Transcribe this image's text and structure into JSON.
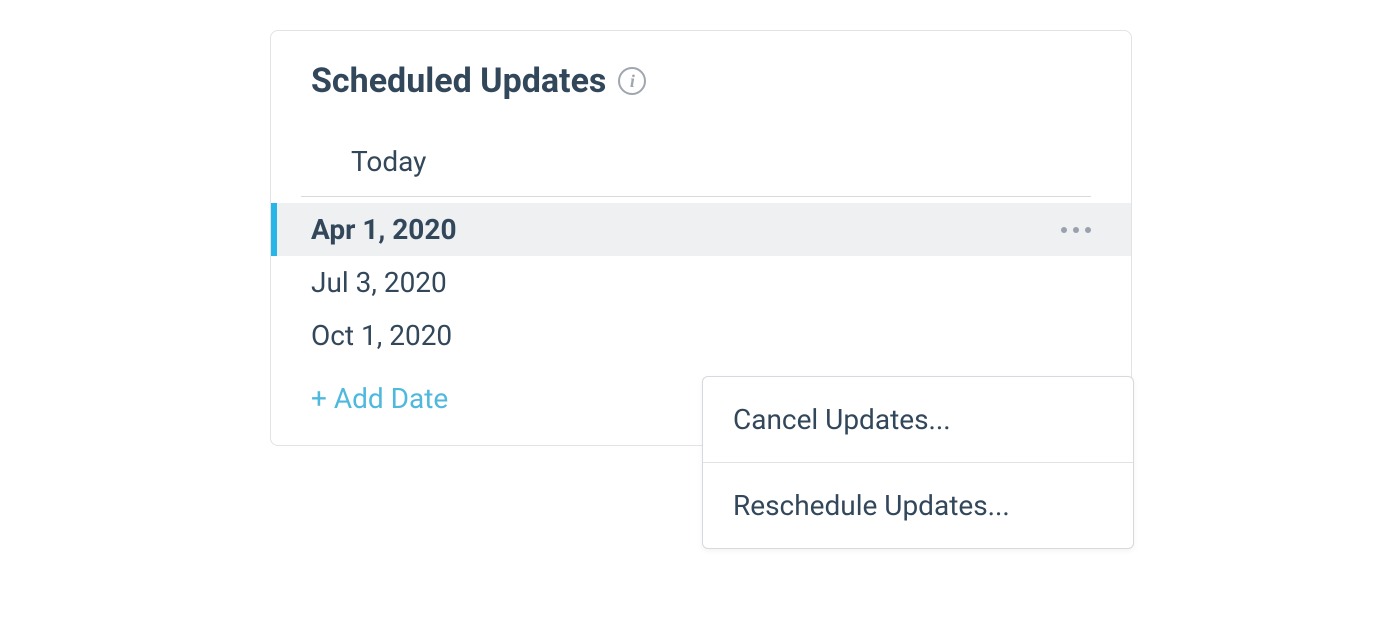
{
  "panel": {
    "title": "Scheduled Updates",
    "today_label": "Today",
    "dates": [
      {
        "label": "Apr 1, 2020",
        "active": true
      },
      {
        "label": "Jul 3, 2020",
        "active": false
      },
      {
        "label": "Oct 1, 2020",
        "active": false
      }
    ],
    "add_date_label": "+ Add Date"
  },
  "dropdown": {
    "items": [
      {
        "label": "Cancel Updates..."
      },
      {
        "label": "Reschedule Updates..."
      }
    ]
  }
}
